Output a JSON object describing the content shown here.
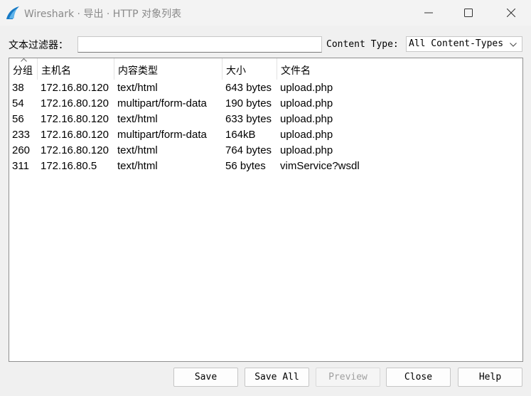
{
  "window": {
    "title": "Wireshark · 导出 · HTTP 对象列表",
    "icon": "wireshark-fin-icon"
  },
  "filter": {
    "label": "文本过滤器：",
    "value": "",
    "placeholder": ""
  },
  "content_type": {
    "label": "Content Type:",
    "selected": "All Content-Types"
  },
  "table": {
    "headers": [
      "分组",
      "主机名",
      "内容类型",
      "大小",
      "文件名"
    ],
    "sorted_column": "分组",
    "rows": [
      [
        "38",
        "172.16.80.120",
        "text/html",
        "643 bytes",
        "upload.php"
      ],
      [
        "54",
        "172.16.80.120",
        "multipart/form-data",
        "190 bytes",
        "upload.php"
      ],
      [
        "56",
        "172.16.80.120",
        "text/html",
        "633 bytes",
        "upload.php"
      ],
      [
        "233",
        "172.16.80.120",
        "multipart/form-data",
        "164kB",
        "upload.php"
      ],
      [
        "260",
        "172.16.80.120",
        "text/html",
        "764 bytes",
        "upload.php"
      ],
      [
        "311",
        "172.16.80.5",
        "text/html",
        "56 bytes",
        "vimService?wsdl"
      ]
    ]
  },
  "buttons": {
    "save": "Save",
    "save_all": "Save All",
    "preview": "Preview",
    "close": "Close",
    "help": "Help"
  },
  "colors": {
    "accent": "#1679c4",
    "title_text": "#8a8a8a",
    "disabled_text": "#a0a0a0"
  }
}
